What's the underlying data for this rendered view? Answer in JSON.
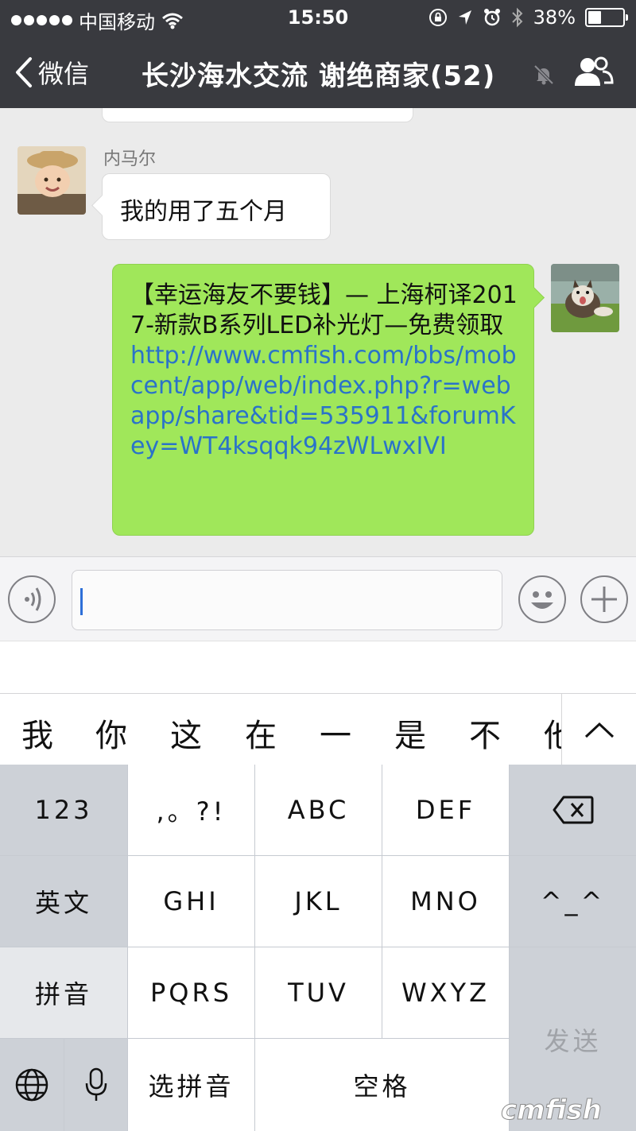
{
  "status_bar": {
    "carrier": "中国移动",
    "time": "15:50",
    "battery_percent": "38%",
    "battery_level": 0.38
  },
  "nav": {
    "back_label": "微信",
    "chat_title": "长沙海水交流 谢绝商家(52)"
  },
  "messages": {
    "incoming": {
      "sender": "内马尔",
      "text": "我的用了五个月"
    },
    "outgoing": {
      "text": "【幸运海友不要钱】— 上海柯译2017-新款B系列LED补光灯—免费领取 ",
      "link": "http://www.cmfish.com/bbs/mobcent/app/web/index.php?r=webapp/share&tid=535911&forumKey=WT4ksqqk94zWLwxIVI"
    }
  },
  "candidates": [
    "我",
    "你",
    "这",
    "在",
    "一",
    "是",
    "不",
    "他"
  ],
  "keyboard": {
    "row1": [
      "123",
      ",。?!",
      "ABC",
      "DEF"
    ],
    "row2": [
      "英文",
      "GHI",
      "JKL",
      "MNO",
      "^_^"
    ],
    "row3": [
      "拼音",
      "PQRS",
      "TUV",
      "WXYZ"
    ],
    "send": "发送",
    "row4": [
      "选拼音",
      "空格"
    ]
  },
  "watermark": "cmfish",
  "colors": {
    "nav_bg": "#393a3f",
    "bubble_green": "#a0e75a",
    "link_blue": "#2a73c9"
  }
}
